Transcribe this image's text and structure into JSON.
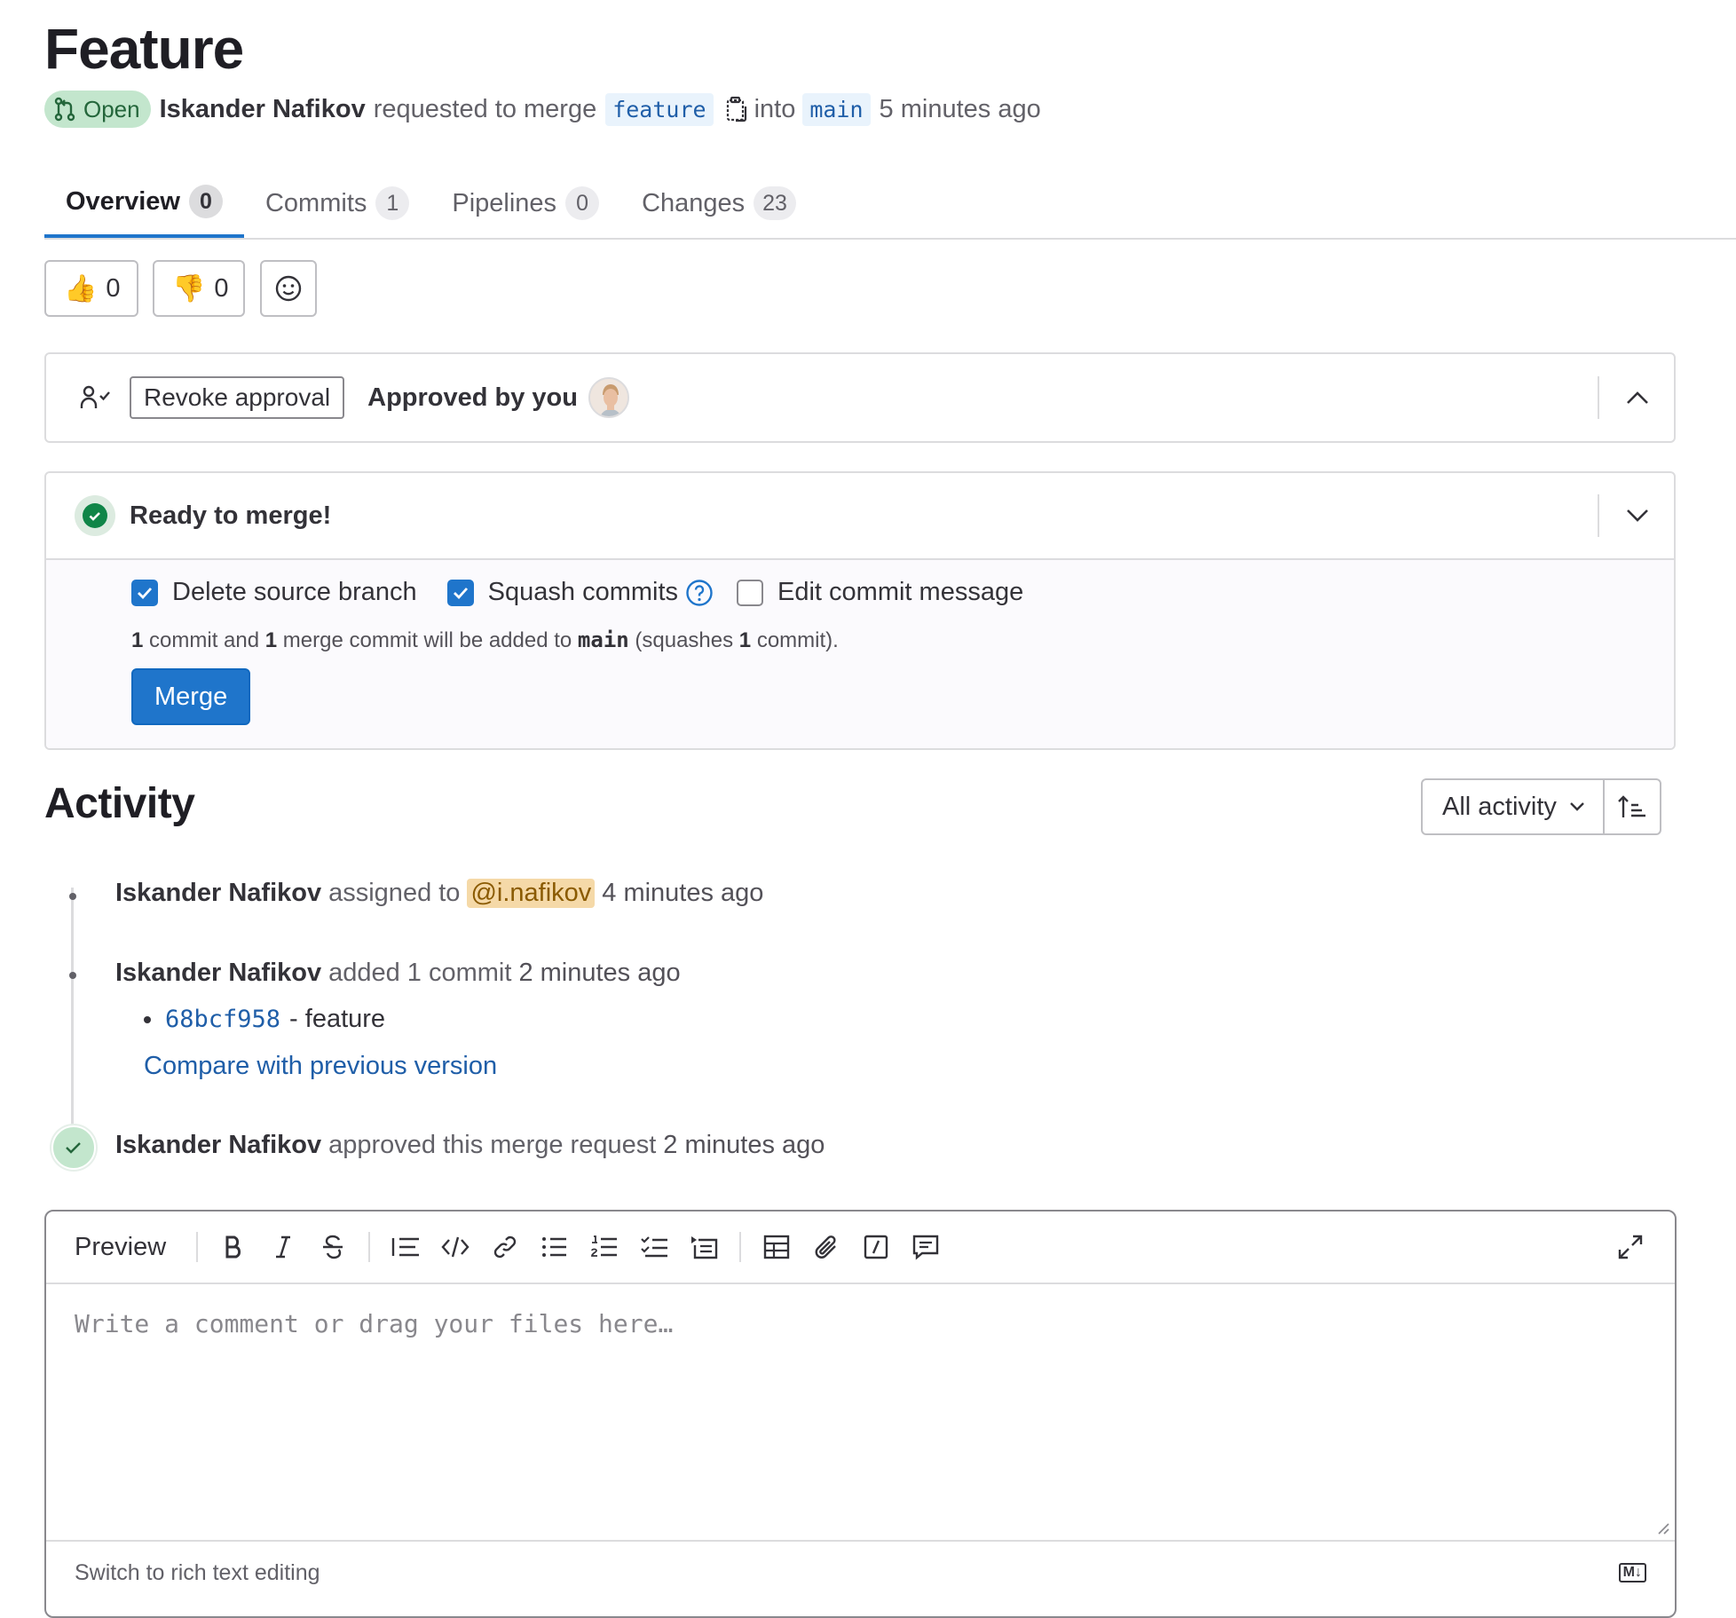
{
  "mr": {
    "title": "Feature",
    "status": "Open",
    "author": "Iskander Nafikov",
    "requested_text": "requested to merge",
    "source_branch": "feature",
    "into_text": "into",
    "target_branch": "main",
    "time_ago": "5 minutes ago"
  },
  "tabs": [
    {
      "label": "Overview",
      "count": "0"
    },
    {
      "label": "Commits",
      "count": "1"
    },
    {
      "label": "Pipelines",
      "count": "0"
    },
    {
      "label": "Changes",
      "count": "23"
    }
  ],
  "reactions": {
    "thumbs_up": "0",
    "thumbs_down": "0"
  },
  "approval": {
    "revoke_label": "Revoke approval",
    "approved_text": "Approved by you"
  },
  "merge": {
    "ready_text": "Ready to merge!",
    "delete_branch_label": "Delete source branch",
    "squash_label": "Squash commits",
    "edit_message_label": "Edit commit message",
    "info": {
      "n1": "1",
      "t1": " commit and ",
      "n2": "1",
      "t2": " merge commit will be added to ",
      "branch": "main",
      "t3": " (squashes ",
      "n3": "1",
      "t4": " commit)."
    },
    "merge_button": "Merge"
  },
  "activity": {
    "heading": "Activity",
    "filter_label": "All activity",
    "notes": [
      {
        "author": "Iskander Nafikov",
        "action": "assigned to",
        "mention": "@i.nafikov",
        "time": "4 minutes ago"
      },
      {
        "author": "Iskander Nafikov",
        "action": "added 1 commit",
        "time": "2 minutes ago",
        "commit_sha": "68bcf958",
        "commit_title": "- feature",
        "compare_link": "Compare with previous version"
      },
      {
        "author": "Iskander Nafikov",
        "action": "approved this merge request",
        "time": "2 minutes ago"
      }
    ]
  },
  "editor": {
    "preview_label": "Preview",
    "placeholder": "Write a comment or drag your files here…",
    "switch_label": "Switch to rich text editing",
    "markdown_badge": "M↓"
  },
  "colors": {
    "accent": "#1f75cb",
    "success": "#108548",
    "open_badge_bg": "#c3e6cd"
  }
}
